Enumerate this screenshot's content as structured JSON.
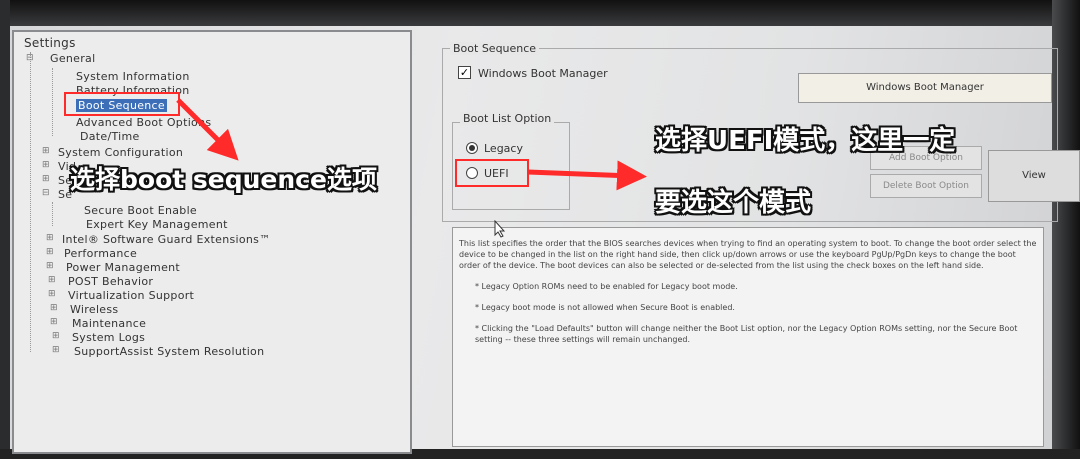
{
  "tree": {
    "root": "Settings",
    "items": [
      {
        "label": "General",
        "level": 1
      },
      {
        "label": "System Information",
        "level": 2
      },
      {
        "label": "Battery Information",
        "level": 2
      },
      {
        "label": "Boot Sequence",
        "level": 2,
        "selected": true
      },
      {
        "label": "Advanced Boot Options",
        "level": 2
      },
      {
        "label": "Date/Time",
        "level": 2
      },
      {
        "label": "System Configuration",
        "level": 1
      },
      {
        "label": "Vid",
        "level": 1
      },
      {
        "label": "Se",
        "level": 1
      },
      {
        "label": "Se",
        "level": 1
      },
      {
        "label": "Secure Boot Enable",
        "level": 2
      },
      {
        "label": "Expert Key Management",
        "level": 2
      },
      {
        "label": "Intel® Software Guard Extensions™",
        "level": 1
      },
      {
        "label": "Performance",
        "level": 1
      },
      {
        "label": "Power Management",
        "level": 1
      },
      {
        "label": "POST Behavior",
        "level": 1
      },
      {
        "label": "Virtualization Support",
        "level": 1
      },
      {
        "label": "Wireless",
        "level": 1
      },
      {
        "label": "Maintenance",
        "level": 1
      },
      {
        "label": "System Logs",
        "level": 1
      },
      {
        "label": "SupportAssist System Resolution",
        "level": 1
      }
    ]
  },
  "boot_sequence": {
    "title": "Boot Sequence",
    "checkbox_label": "Windows Boot Manager",
    "checkbox_checked": true,
    "list_item": "Windows Boot Manager"
  },
  "boot_list_option": {
    "title": "Boot List Option",
    "options": [
      "Legacy",
      "UEFI"
    ],
    "selected": "Legacy"
  },
  "buttons": {
    "add": "Add Boot Option",
    "delete": "Delete Boot Option",
    "view": "View"
  },
  "description": {
    "paragraph": "This list specifies the order that the BIOS searches devices when trying to find an operating system to boot. To change the boot order select the device to be changed in the list on the right hand side, then click up/down arrows or use the keyboard PgUp/PgDn keys to change the boot order of the device. The boot devices can also be selected or de-selected from the list using the check boxes on the left hand side.",
    "bullets": [
      "* Legacy Option ROMs need to be enabled for Legacy boot mode.",
      "* Legacy boot mode is not allowed when Secure Boot is enabled.",
      "* Clicking the \"Load Defaults\" button will change neither the Boot List option, nor the Legacy Option ROMs setting, nor the Secure Boot setting -- these three settings will remain unchanged."
    ]
  },
  "annotations": {
    "left": "选择boot sequence选项",
    "right_line1": "选择UEFI模式，这里一定",
    "right_line2": "要选这个模式"
  },
  "colors": {
    "annotation_red": "#ff2a2a",
    "selection_blue": "#3d6fb8"
  }
}
